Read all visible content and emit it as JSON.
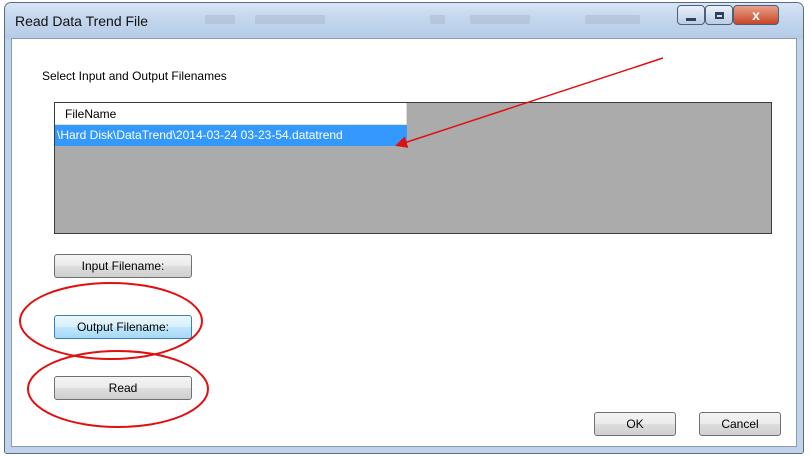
{
  "window": {
    "title": "Read Data Trend File",
    "caption_buttons": {
      "minimize": "–",
      "maximize": "□",
      "close": "x"
    }
  },
  "form": {
    "instruction_label": "Select Input and Output Filenames",
    "listview": {
      "column_header": "FileName",
      "rows": [
        "\\Hard Disk\\DataTrend\\2014-03-24 03-23-54.datatrend"
      ]
    },
    "input_button": "Input Filename:",
    "output_button": "Output Filename:",
    "read_button": "Read",
    "ok_button": "OK",
    "cancel_button": "Cancel"
  },
  "annotations": {
    "color": "#e01010"
  }
}
